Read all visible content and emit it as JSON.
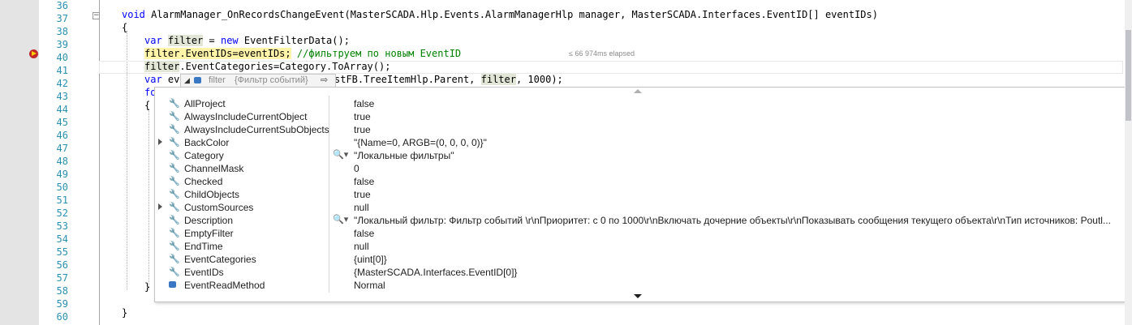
{
  "line_numbers": [
    "36",
    "37",
    "38",
    "39",
    "40",
    "41",
    "42",
    "43",
    "44",
    "45",
    "46",
    "47",
    "48",
    "49",
    "50",
    "51",
    "52",
    "53",
    "54",
    "55",
    "56",
    "57",
    "58",
    "59",
    "60"
  ],
  "code": {
    "l36_void": "void",
    "l36_rest": " AlarmManager_OnRecordsChangeEvent(MasterSCADA.Hlp.Events.AlarmManagerHlp manager, MasterSCADA.Interfaces.EventID[] eventIDs)",
    "l37": "{",
    "l38_var": "var",
    "l38_filter": "filter",
    "l38_eq": " = ",
    "l38_new": "new",
    "l38_rest": " EventFilterData();",
    "l39_filter": "filter",
    "l39_stmt": ".EventIDs=eventIDs;",
    "l39_comment": " //фильтруем по новым EventID",
    "l40_filter": "filter",
    "l40_rest": ".EventCategories=Category.ToArray();",
    "l41_var": "var",
    "l41_ev": " ev",
    "l41_tail_a": "stFB.TreeItemHlp.Parent, ",
    "l41_filter": "filter",
    "l41_tail_b": ", 1000);",
    "l42": "fo",
    "l43": "{",
    "l57": "}",
    "l59": "}",
    "collapse_glyph": "−"
  },
  "elapsed": "≤ 66 974ms elapsed",
  "datatip": {
    "expand_glyph": "◢",
    "icon_color": "#3a78c4",
    "name": "filter",
    "type": "{Фильтр событий}",
    "pin_glyph": "⇨"
  },
  "properties": [
    {
      "name": "AllProject",
      "value": "false",
      "expandable": false,
      "icon": "wrench-icon",
      "magnifier": false
    },
    {
      "name": "AlwaysIncludeCurrentObject",
      "value": "true",
      "expandable": false,
      "icon": "wrench-icon",
      "magnifier": false
    },
    {
      "name": "AlwaysIncludeCurrentSubObjects",
      "value": "true",
      "expandable": false,
      "icon": "wrench-icon",
      "magnifier": false
    },
    {
      "name": "BackColor",
      "value": "\"{Name=0, ARGB=(0, 0, 0, 0)}\"",
      "expandable": true,
      "icon": "wrench-icon",
      "magnifier": false
    },
    {
      "name": "Category",
      "value": "\"Локальные фильтры\"",
      "expandable": false,
      "icon": "wrench-icon",
      "magnifier": true
    },
    {
      "name": "ChannelMask",
      "value": "0",
      "expandable": false,
      "icon": "wrench-icon",
      "magnifier": false
    },
    {
      "name": "Checked",
      "value": "false",
      "expandable": false,
      "icon": "wrench-icon",
      "magnifier": false
    },
    {
      "name": "ChildObjects",
      "value": "true",
      "expandable": false,
      "icon": "wrench-icon",
      "magnifier": false
    },
    {
      "name": "CustomSources",
      "value": "null",
      "expandable": true,
      "icon": "wrench-icon",
      "magnifier": false
    },
    {
      "name": "Description",
      "value": "\"Локальный фильтр: Фильтр событий \\r\\nПриоритет: с 0 по 1000\\r\\nВключать дочерние объекты\\r\\nПоказывать сообщения текущего объекта\\r\\nТип источников: Poutl...",
      "expandable": false,
      "icon": "wrench-icon",
      "magnifier": true
    },
    {
      "name": "EmptyFilter",
      "value": "false",
      "expandable": false,
      "icon": "wrench-icon",
      "magnifier": false
    },
    {
      "name": "EndTime",
      "value": "null",
      "expandable": false,
      "icon": "wrench-icon",
      "magnifier": false
    },
    {
      "name": "EventCategories",
      "value": "{uint[0]}",
      "expandable": false,
      "icon": "wrench-icon",
      "magnifier": false
    },
    {
      "name": "EventIDs",
      "value": "{MasterSCADA.Interfaces.EventID[0]}",
      "expandable": false,
      "icon": "wrench-icon",
      "magnifier": false
    },
    {
      "name": "EventReadMethod",
      "value": "Normal",
      "expandable": false,
      "icon": "cube-icon",
      "magnifier": false
    }
  ],
  "glyphs": {
    "wrench": "🔧",
    "magnifier": "🔍▾"
  },
  "colors": {
    "breakpoint": "#c0282c",
    "current_statement_arrow": "#ffd000",
    "keyword": "#0000ff",
    "comment": "#008000",
    "line_number": "#2b91af"
  }
}
